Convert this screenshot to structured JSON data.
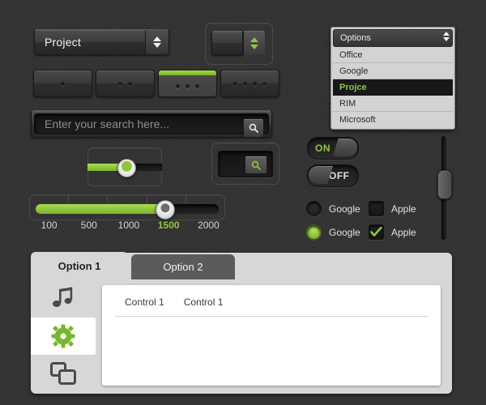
{
  "theme": {
    "background": "#333333",
    "accent_green": "#8fc63d",
    "panel_light": "#d7d7d7",
    "content_white": "#ffffff"
  },
  "project_select": {
    "value": "Project",
    "stepper_icon_up": "triangle-up-icon",
    "stepper_icon_down": "triangle-down-icon"
  },
  "stepper_box": {
    "value": "",
    "icon_up": "triangle-up-icon",
    "icon_down": "triangle-down-icon"
  },
  "segmented": {
    "buttons": [
      {
        "name": "segment-1",
        "dots": 1,
        "active": false
      },
      {
        "name": "segment-2",
        "dots": 2,
        "active": false
      },
      {
        "name": "segment-3",
        "dots": 3,
        "active": true
      },
      {
        "name": "segment-4",
        "dots": 4,
        "active": false
      }
    ]
  },
  "search": {
    "value": "",
    "placeholder": "Enter your search here...",
    "button_icon": "search-icon"
  },
  "mini_slider": {
    "fill_percent": 48
  },
  "search_button_box": {
    "button_icon": "search-icon"
  },
  "range_slider": {
    "fill_percent": 72,
    "value": "1500",
    "ticks": [
      {
        "label": "100",
        "active": false
      },
      {
        "label": "500",
        "active": false
      },
      {
        "label": "1000",
        "active": false
      },
      {
        "label": "1500",
        "active": true
      },
      {
        "label": "2000",
        "active": false
      }
    ]
  },
  "toggles": [
    {
      "name": "toggle-on",
      "label": "ON",
      "state": "on"
    },
    {
      "name": "toggle-off",
      "label": "OFF",
      "state": "off"
    }
  ],
  "options": {
    "radio_unchecked_label": "Google",
    "radio_checked_label": "Google",
    "check_unchecked_label": "Apple",
    "check_checked_label": "Apple",
    "check_icon": "checkmark-icon"
  },
  "vertical_slider": {
    "value_percent": 45
  },
  "dropdown": {
    "header": "Options",
    "items": [
      {
        "label": "Office",
        "selected": false
      },
      {
        "label": "Google",
        "selected": false
      },
      {
        "label": "Projce",
        "selected": true
      },
      {
        "label": "RIM",
        "selected": false
      },
      {
        "label": "Microsoft",
        "selected": false
      }
    ]
  },
  "tabs": [
    {
      "label": "Option 1",
      "active": true
    },
    {
      "label": "Option 2",
      "active": false
    }
  ],
  "icon_rail": [
    {
      "name": "music-note-icon",
      "selected": false
    },
    {
      "name": "gear-icon",
      "selected": true
    },
    {
      "name": "windows-copy-icon",
      "selected": false
    }
  ],
  "content": {
    "labels": [
      "Control  1",
      "Control  1"
    ]
  }
}
